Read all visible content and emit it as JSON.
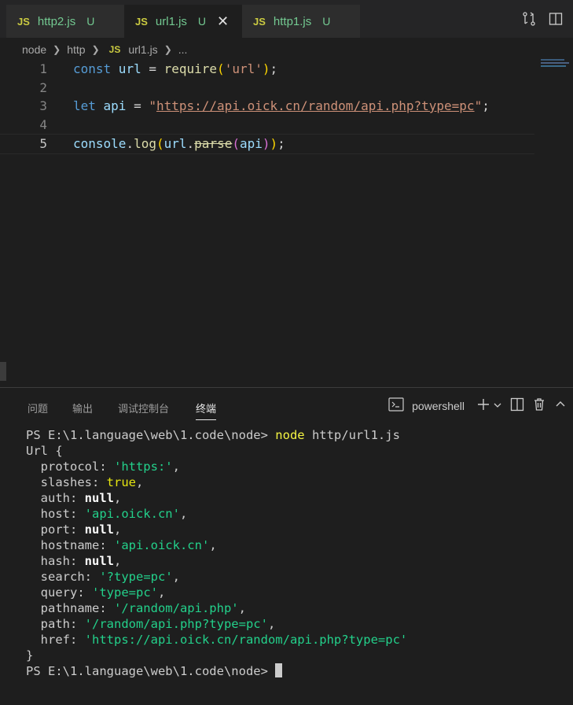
{
  "tabs": [
    {
      "lang": "JS",
      "name": "http2.js",
      "status": "U"
    },
    {
      "lang": "JS",
      "name": "url1.js",
      "status": "U",
      "close": "✕"
    },
    {
      "lang": "JS",
      "name": "http1.js",
      "status": "U"
    }
  ],
  "breadcrumb": {
    "seg1": "node",
    "seg2": "http",
    "lang": "JS",
    "file": "url1.js",
    "more": "..."
  },
  "editor": {
    "line_numbers": [
      "1",
      "2",
      "3",
      "4",
      "5"
    ],
    "line1": {
      "kw": "const",
      "var": " url",
      "eq": " = ",
      "fn": "require",
      "open": "(",
      "str": "'url'",
      "close": ")",
      "end": ";"
    },
    "line3": {
      "kw": "let",
      "var": " api",
      "eq": " = ",
      "q1": "\"",
      "url": "https://api.oick.cn/random/api.php?type=pc",
      "q2": "\"",
      "end": ";"
    },
    "line5": {
      "obj": "console",
      "dot": ".",
      "fn": "log",
      "open1": "(",
      "var": "url",
      "dot2": ".",
      "method": "parse",
      "open2": "(",
      "arg": "api",
      "close2": ")",
      "close1": ")",
      "end": ";"
    }
  },
  "panel": {
    "tabs": [
      "问题",
      "输出",
      "调试控制台",
      "终端"
    ],
    "active_tab": "终端",
    "shell": "powershell"
  },
  "terminal": {
    "prompt": "PS E:\\1.language\\web\\1.code\\node> ",
    "cmd_node": "node",
    "cmd_arg": " http/url1.js",
    "open": "Url {",
    "fields": [
      {
        "key": "  protocol: ",
        "val": "'https:'",
        "type": "str"
      },
      {
        "key": "  slashes: ",
        "val": "true",
        "type": "bool"
      },
      {
        "key": "  auth: ",
        "val": "null",
        "type": "null"
      },
      {
        "key": "  host: ",
        "val": "'api.oick.cn'",
        "type": "str"
      },
      {
        "key": "  port: ",
        "val": "null",
        "type": "null"
      },
      {
        "key": "  hostname: ",
        "val": "'api.oick.cn'",
        "type": "str"
      },
      {
        "key": "  hash: ",
        "val": "null",
        "type": "null"
      },
      {
        "key": "  search: ",
        "val": "'?type=pc'",
        "type": "str"
      },
      {
        "key": "  query: ",
        "val": "'type=pc'",
        "type": "str"
      },
      {
        "key": "  pathname: ",
        "val": "'/random/api.php'",
        "type": "str"
      },
      {
        "key": "  path: ",
        "val": "'/random/api.php?type=pc'",
        "type": "str"
      },
      {
        "key": "  href: ",
        "val": "'https://api.oick.cn/random/api.php?type=pc'",
        "type": "str",
        "last": true
      }
    ],
    "close": "}",
    "final_prompt": "PS E:\\1.language\\web\\1.code\\node> "
  },
  "colors": {
    "accent_string": "#ce9178",
    "terminal_string": "#23d18b",
    "terminal_command": "#f5f543"
  }
}
